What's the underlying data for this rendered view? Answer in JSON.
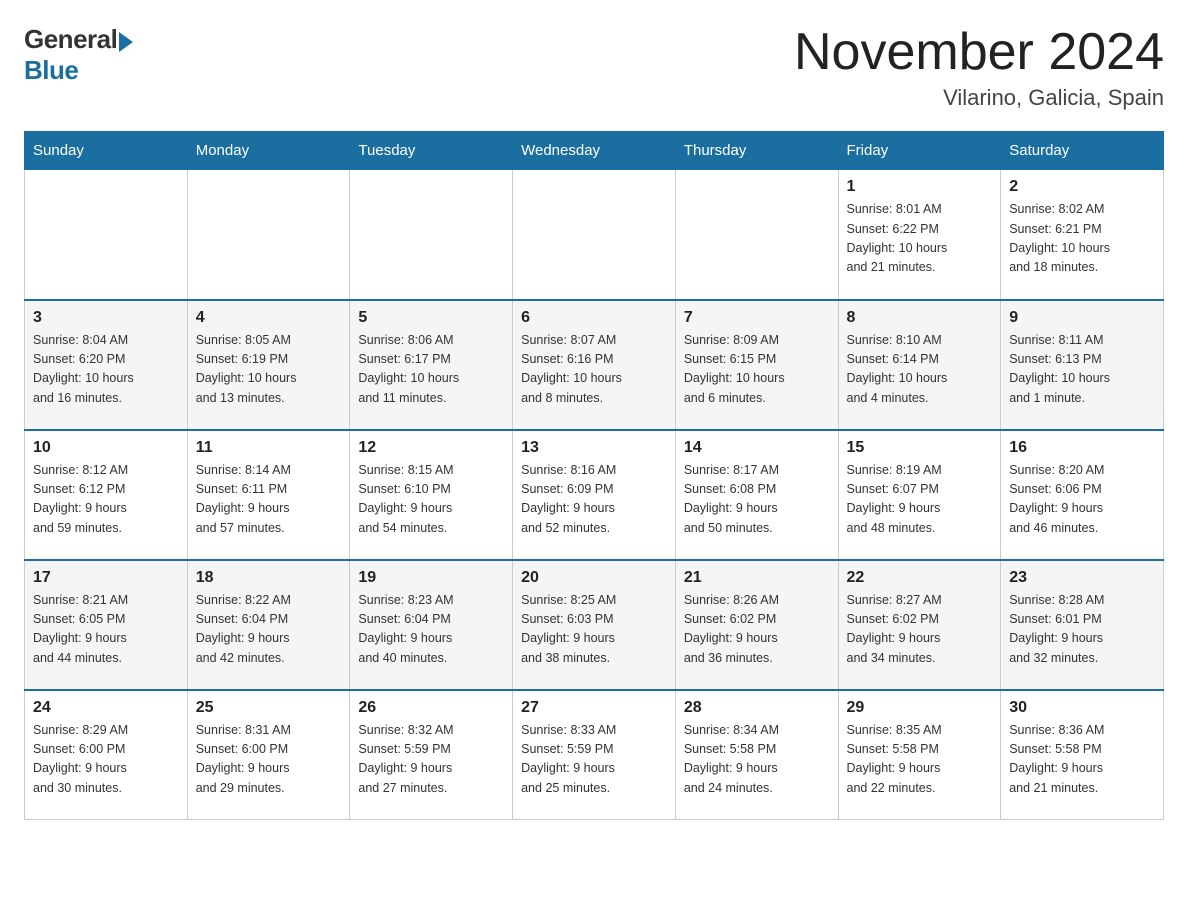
{
  "header": {
    "logo_general": "General",
    "logo_blue": "Blue",
    "title": "November 2024",
    "subtitle": "Vilarino, Galicia, Spain"
  },
  "weekdays": [
    "Sunday",
    "Monday",
    "Tuesday",
    "Wednesday",
    "Thursday",
    "Friday",
    "Saturday"
  ],
  "weeks": [
    [
      {
        "day": "",
        "info": ""
      },
      {
        "day": "",
        "info": ""
      },
      {
        "day": "",
        "info": ""
      },
      {
        "day": "",
        "info": ""
      },
      {
        "day": "",
        "info": ""
      },
      {
        "day": "1",
        "info": "Sunrise: 8:01 AM\nSunset: 6:22 PM\nDaylight: 10 hours\nand 21 minutes."
      },
      {
        "day": "2",
        "info": "Sunrise: 8:02 AM\nSunset: 6:21 PM\nDaylight: 10 hours\nand 18 minutes."
      }
    ],
    [
      {
        "day": "3",
        "info": "Sunrise: 8:04 AM\nSunset: 6:20 PM\nDaylight: 10 hours\nand 16 minutes."
      },
      {
        "day": "4",
        "info": "Sunrise: 8:05 AM\nSunset: 6:19 PM\nDaylight: 10 hours\nand 13 minutes."
      },
      {
        "day": "5",
        "info": "Sunrise: 8:06 AM\nSunset: 6:17 PM\nDaylight: 10 hours\nand 11 minutes."
      },
      {
        "day": "6",
        "info": "Sunrise: 8:07 AM\nSunset: 6:16 PM\nDaylight: 10 hours\nand 8 minutes."
      },
      {
        "day": "7",
        "info": "Sunrise: 8:09 AM\nSunset: 6:15 PM\nDaylight: 10 hours\nand 6 minutes."
      },
      {
        "day": "8",
        "info": "Sunrise: 8:10 AM\nSunset: 6:14 PM\nDaylight: 10 hours\nand 4 minutes."
      },
      {
        "day": "9",
        "info": "Sunrise: 8:11 AM\nSunset: 6:13 PM\nDaylight: 10 hours\nand 1 minute."
      }
    ],
    [
      {
        "day": "10",
        "info": "Sunrise: 8:12 AM\nSunset: 6:12 PM\nDaylight: 9 hours\nand 59 minutes."
      },
      {
        "day": "11",
        "info": "Sunrise: 8:14 AM\nSunset: 6:11 PM\nDaylight: 9 hours\nand 57 minutes."
      },
      {
        "day": "12",
        "info": "Sunrise: 8:15 AM\nSunset: 6:10 PM\nDaylight: 9 hours\nand 54 minutes."
      },
      {
        "day": "13",
        "info": "Sunrise: 8:16 AM\nSunset: 6:09 PM\nDaylight: 9 hours\nand 52 minutes."
      },
      {
        "day": "14",
        "info": "Sunrise: 8:17 AM\nSunset: 6:08 PM\nDaylight: 9 hours\nand 50 minutes."
      },
      {
        "day": "15",
        "info": "Sunrise: 8:19 AM\nSunset: 6:07 PM\nDaylight: 9 hours\nand 48 minutes."
      },
      {
        "day": "16",
        "info": "Sunrise: 8:20 AM\nSunset: 6:06 PM\nDaylight: 9 hours\nand 46 minutes."
      }
    ],
    [
      {
        "day": "17",
        "info": "Sunrise: 8:21 AM\nSunset: 6:05 PM\nDaylight: 9 hours\nand 44 minutes."
      },
      {
        "day": "18",
        "info": "Sunrise: 8:22 AM\nSunset: 6:04 PM\nDaylight: 9 hours\nand 42 minutes."
      },
      {
        "day": "19",
        "info": "Sunrise: 8:23 AM\nSunset: 6:04 PM\nDaylight: 9 hours\nand 40 minutes."
      },
      {
        "day": "20",
        "info": "Sunrise: 8:25 AM\nSunset: 6:03 PM\nDaylight: 9 hours\nand 38 minutes."
      },
      {
        "day": "21",
        "info": "Sunrise: 8:26 AM\nSunset: 6:02 PM\nDaylight: 9 hours\nand 36 minutes."
      },
      {
        "day": "22",
        "info": "Sunrise: 8:27 AM\nSunset: 6:02 PM\nDaylight: 9 hours\nand 34 minutes."
      },
      {
        "day": "23",
        "info": "Sunrise: 8:28 AM\nSunset: 6:01 PM\nDaylight: 9 hours\nand 32 minutes."
      }
    ],
    [
      {
        "day": "24",
        "info": "Sunrise: 8:29 AM\nSunset: 6:00 PM\nDaylight: 9 hours\nand 30 minutes."
      },
      {
        "day": "25",
        "info": "Sunrise: 8:31 AM\nSunset: 6:00 PM\nDaylight: 9 hours\nand 29 minutes."
      },
      {
        "day": "26",
        "info": "Sunrise: 8:32 AM\nSunset: 5:59 PM\nDaylight: 9 hours\nand 27 minutes."
      },
      {
        "day": "27",
        "info": "Sunrise: 8:33 AM\nSunset: 5:59 PM\nDaylight: 9 hours\nand 25 minutes."
      },
      {
        "day": "28",
        "info": "Sunrise: 8:34 AM\nSunset: 5:58 PM\nDaylight: 9 hours\nand 24 minutes."
      },
      {
        "day": "29",
        "info": "Sunrise: 8:35 AM\nSunset: 5:58 PM\nDaylight: 9 hours\nand 22 minutes."
      },
      {
        "day": "30",
        "info": "Sunrise: 8:36 AM\nSunset: 5:58 PM\nDaylight: 9 hours\nand 21 minutes."
      }
    ]
  ]
}
